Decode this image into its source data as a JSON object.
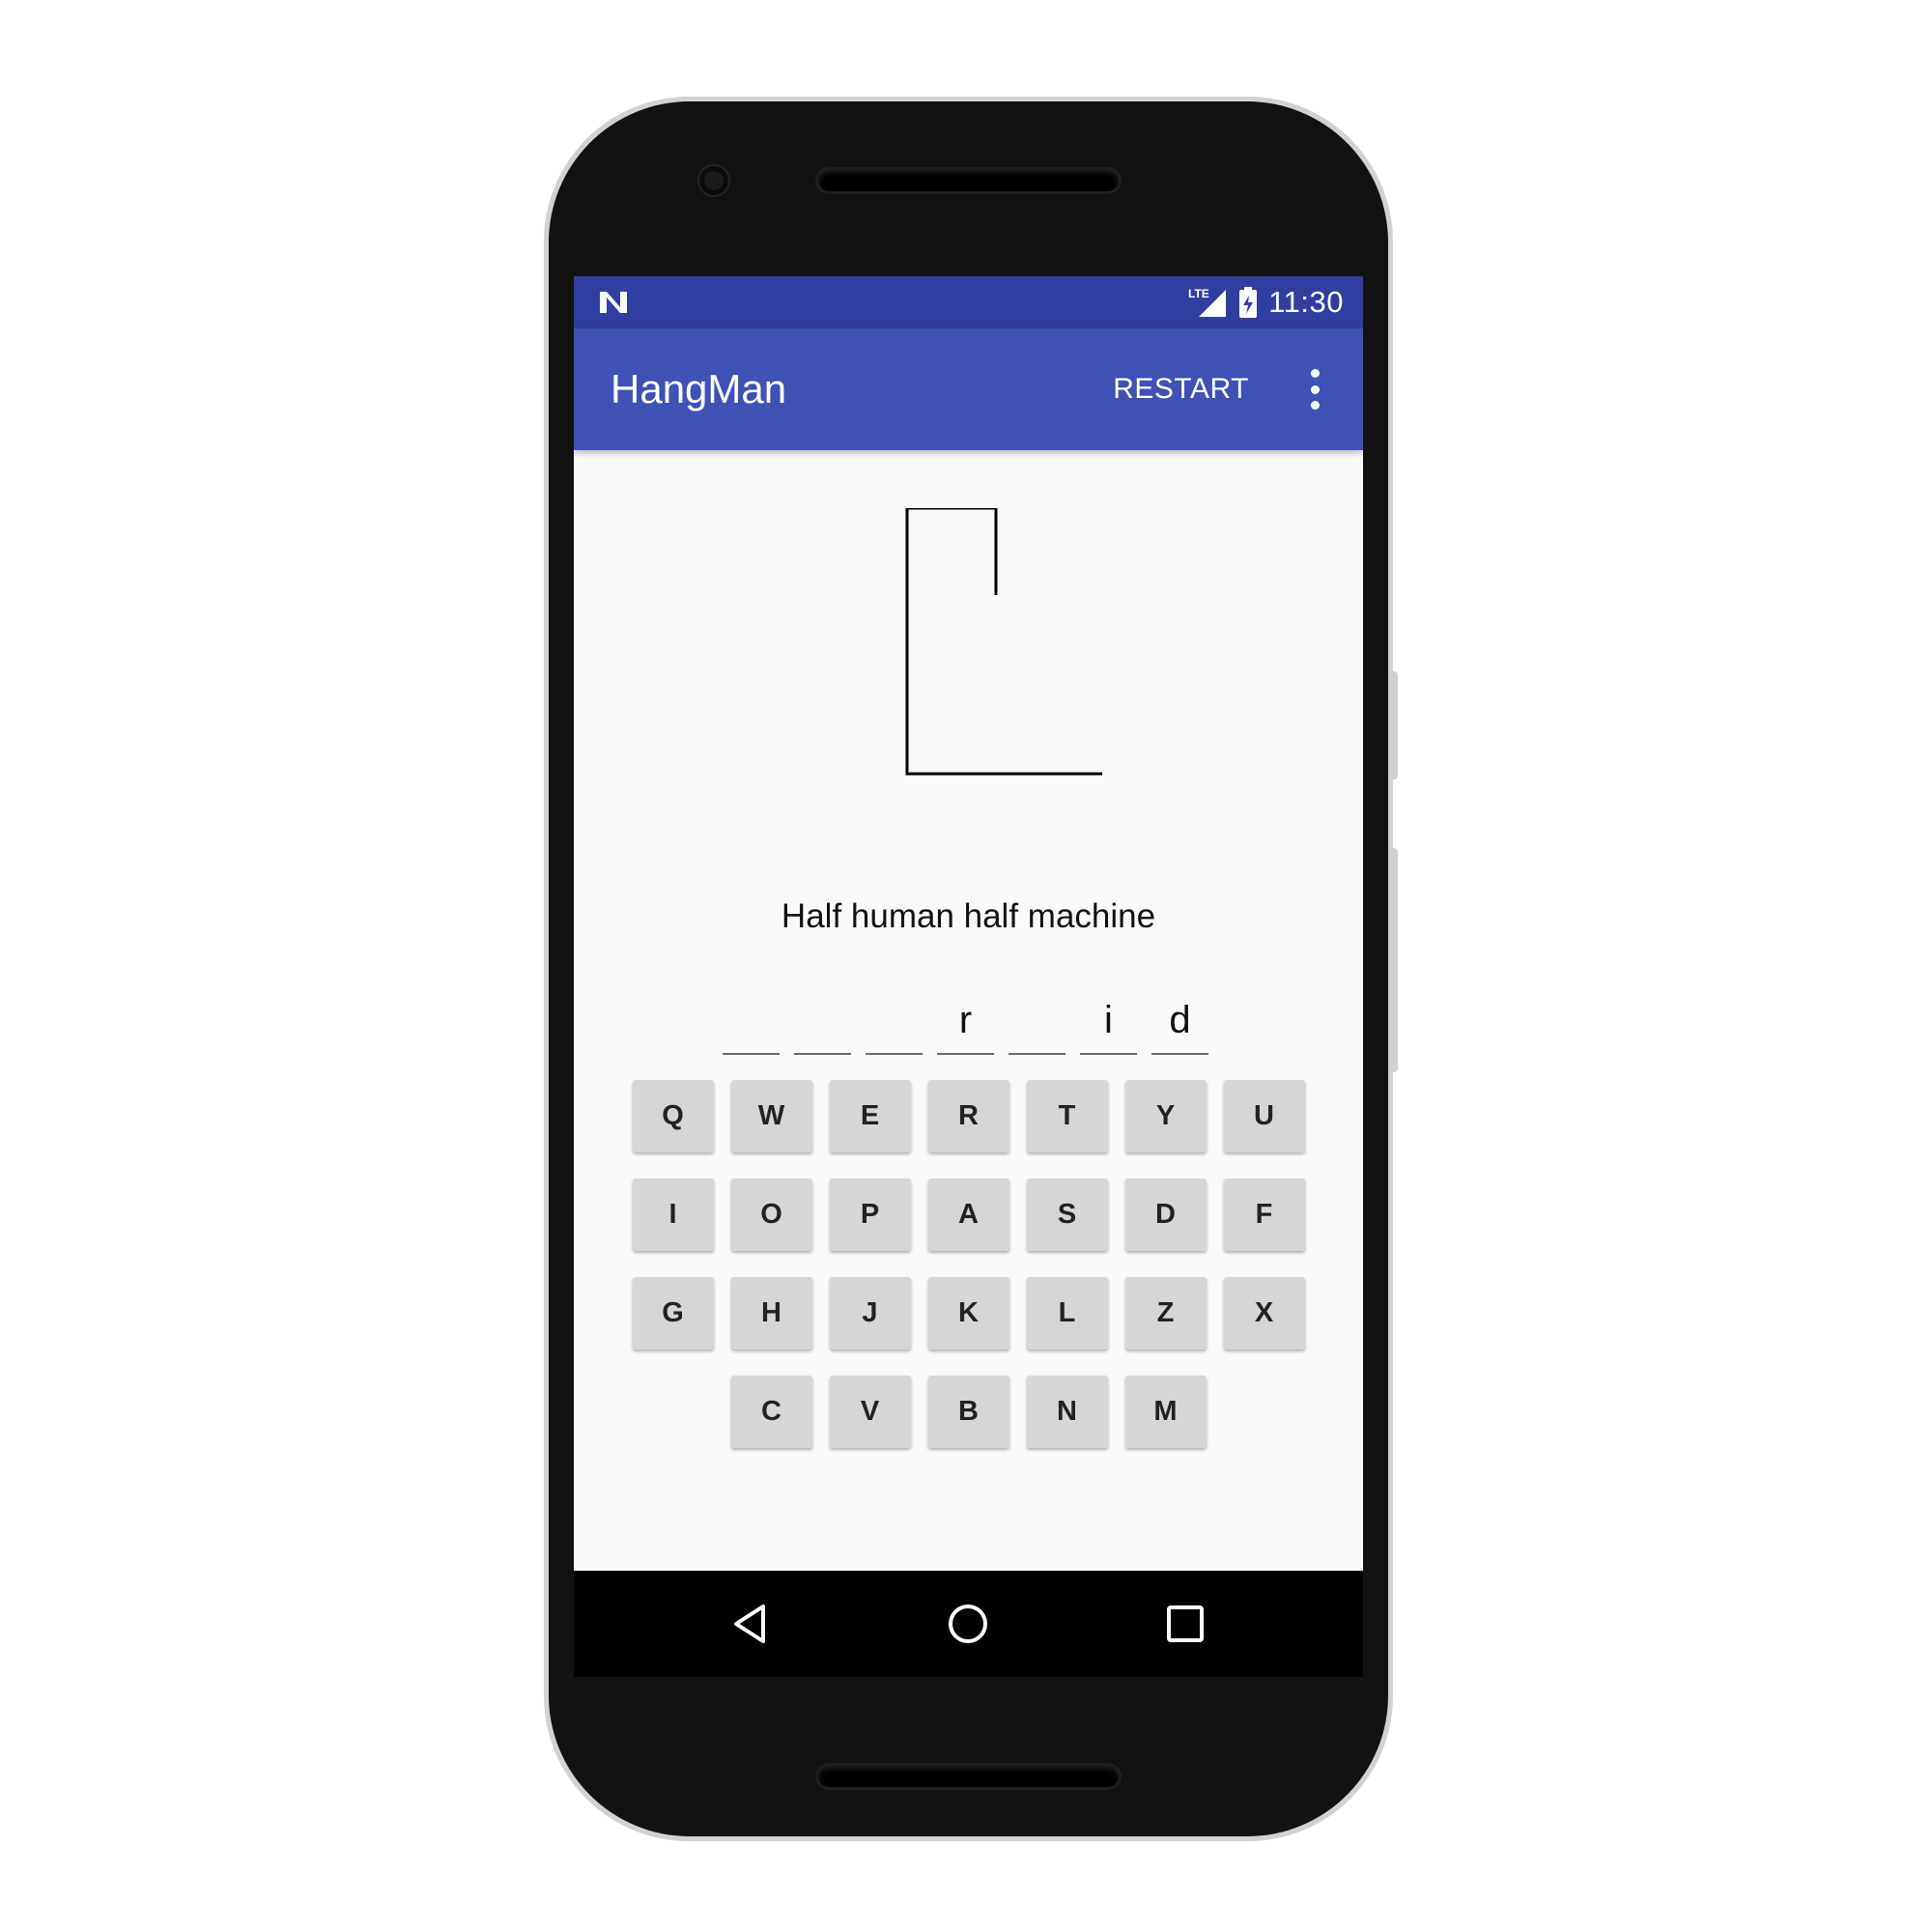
{
  "status_bar": {
    "network": "LTE",
    "time": "11:30"
  },
  "app_bar": {
    "title": "HangMan",
    "restart_label": "RESTART"
  },
  "game": {
    "hint": "Half human half machine",
    "word_slots": [
      "",
      "",
      "",
      "r",
      "",
      "i",
      "d"
    ]
  },
  "keyboard": {
    "rows": [
      [
        "Q",
        "W",
        "E",
        "R",
        "T",
        "Y",
        "U"
      ],
      [
        "I",
        "O",
        "P",
        "A",
        "S",
        "D",
        "F"
      ],
      [
        "G",
        "H",
        "J",
        "K",
        "L",
        "Z",
        "X"
      ],
      [
        "C",
        "V",
        "B",
        "N",
        "M"
      ]
    ]
  },
  "icons": {
    "status": [
      "android-n-icon",
      "lte-signal-icon",
      "battery-charging-icon"
    ],
    "app_bar": [
      "more-vert-icon"
    ],
    "nav": [
      "back-icon",
      "home-icon",
      "recents-icon"
    ]
  }
}
